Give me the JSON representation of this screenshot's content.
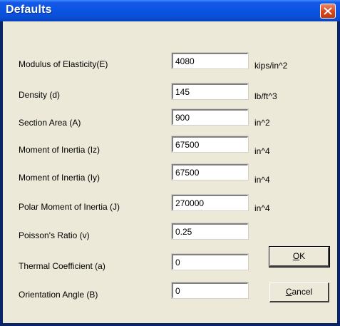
{
  "window": {
    "title": "Defaults"
  },
  "form": {
    "rows": [
      {
        "label": "Modulus of Elasticity(E)",
        "value": "4080",
        "unit": "kips/in^2"
      },
      {
        "label": "Density (d)",
        "value": "145",
        "unit": "lb/ft^3"
      },
      {
        "label": "Section Area (A)",
        "value": "900",
        "unit": "in^2"
      },
      {
        "label": "Moment of Inertia (Iz)",
        "value": "67500",
        "unit": "in^4"
      },
      {
        "label": "Moment of Inertia (Iy)",
        "value": "67500",
        "unit": "in^4"
      },
      {
        "label": "Polar Moment of Inertia (J)",
        "value": "270000",
        "unit": "in^4"
      },
      {
        "label": "Poisson's Ratio (v)",
        "value": "0.25",
        "unit": ""
      },
      {
        "label": "Thermal Coefficient (a)",
        "value": "0",
        "unit": ""
      },
      {
        "label": "Orientation Angle (B)",
        "value": "0",
        "unit": ""
      }
    ]
  },
  "buttons": {
    "ok": {
      "mnemonic": "O",
      "rest": "K"
    },
    "cancel": {
      "mnemonic": "C",
      "rest": "ancel"
    }
  },
  "icons": {
    "close": "close-x-icon"
  },
  "colors": {
    "titlebar": "#0a55e3",
    "close": "#d9491c",
    "dialog_bg": "#ece9d8"
  }
}
